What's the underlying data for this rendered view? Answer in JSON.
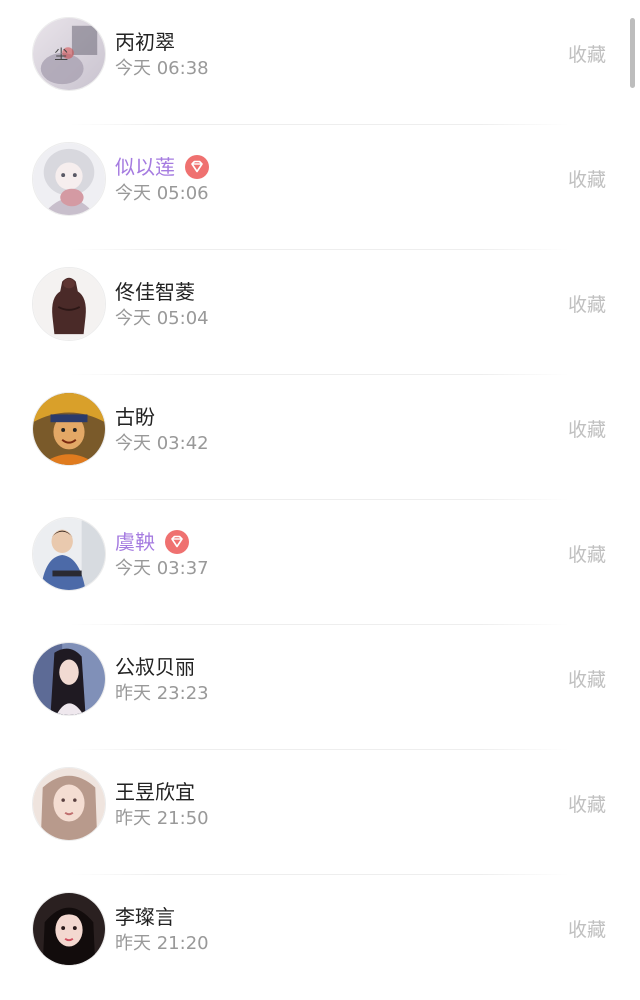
{
  "favorite_label": "收藏",
  "colors": {
    "vip_name": "#a57be0",
    "vip_badge": "#ef7170",
    "name": "#222222",
    "time": "#999999",
    "favorite": "#c0c0c0"
  },
  "users": [
    {
      "name": "丙初翠",
      "time": "今天 06:38",
      "vip": false
    },
    {
      "name": "似以莲",
      "time": "今天 05:06",
      "vip": true
    },
    {
      "name": "佟佳智菱",
      "time": "今天 05:04",
      "vip": false
    },
    {
      "name": "古盼",
      "time": "今天 03:42",
      "vip": false
    },
    {
      "name": "虞鞅",
      "time": "今天 03:37",
      "vip": true
    },
    {
      "name": "公叔贝丽",
      "time": "昨天 23:23",
      "vip": false
    },
    {
      "name": "王昱欣宜",
      "time": "昨天 21:50",
      "vip": false
    },
    {
      "name": "李璨言",
      "time": "昨天 21:20",
      "vip": false
    }
  ]
}
